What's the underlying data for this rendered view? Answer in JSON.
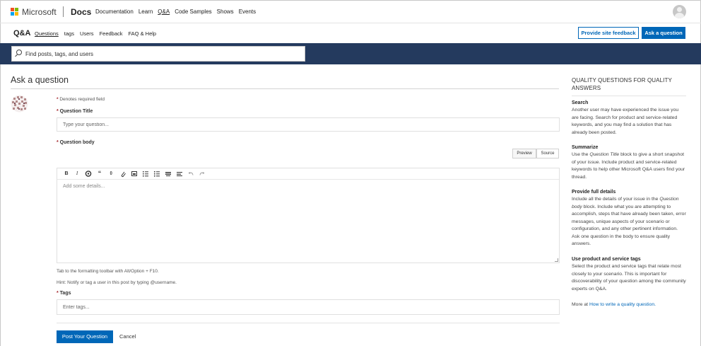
{
  "header": {
    "brand": "Microsoft",
    "product": "Docs",
    "nav": [
      "Documentation",
      "Learn",
      "Q&A",
      "Code Samples",
      "Shows",
      "Events"
    ],
    "active_nav": "Q&A",
    "logo_colors": [
      "#f25022",
      "#7fba00",
      "#00a4ef",
      "#ffb900"
    ]
  },
  "subnav": {
    "title": "Q&A",
    "items": [
      "Questions",
      "tags",
      "Users",
      "Feedback",
      "FAQ & Help"
    ],
    "active": "Questions",
    "feedback_button": "Provide site feedback",
    "ask_button": "Ask a question"
  },
  "search": {
    "placeholder": "Find posts, tags, and users",
    "icon": "search-icon"
  },
  "form": {
    "page_title": "Ask a question",
    "required_note": "Denotes required field",
    "question_title_label": "Question Title",
    "question_title_placeholder": "Type your question...",
    "question_body_label": "Question body",
    "preview_tab": "Preview",
    "source_tab": "Source",
    "editor_placeholder": "Add some details...",
    "toolbar": [
      "B",
      "I",
      "link-icon",
      "“",
      "code-icon",
      "attach-icon",
      "image-icon",
      "ordered-list-icon",
      "unordered-list-icon",
      "heading-icon",
      "hr-icon",
      "undo-icon",
      "redo-icon"
    ],
    "hint_toolbar": "Tab to the formatting toolbar with Alt/Option + F10.",
    "hint_notify": "Hint: Notify or tag a user in this post by typing @username.",
    "tags_label": "Tags",
    "tags_placeholder": "Enter tags...",
    "post_button": "Post Your Question",
    "cancel_button": "Cancel"
  },
  "sidebar": {
    "title": "QUALITY QUESTIONS FOR QUALITY ANSWERS",
    "sections": [
      {
        "heading": "Search",
        "text": "Another user may have experienced the issue you are facing. Search for product and service-related keywords, and you may find a solution that has already been posted."
      },
      {
        "heading": "Summarize",
        "text_before": "Use the ",
        "text_em": "Question Title",
        "text_after": " block to give a short snapshot of your issue. Include product and service-related keywords to help other Microsoft Q&A users find your thread."
      },
      {
        "heading": "Provide full details",
        "text_before": "Include all the details of your issue in the ",
        "text_em": "Question body",
        "text_after": " block. Include what you are attempting to accomplish, steps that have already been taken, error messages, unique aspects of your scenario or configuration, and any other pertinent information. Ask one question in the body to ensure quality answers."
      },
      {
        "heading": "Use product and service tags",
        "text": "Select the product and service tags that relate most closely to your scenario. This is important for discoverability of your question among the community experts on Q&A."
      }
    ],
    "more_prefix": "More at ",
    "more_link": "How to write a quality question."
  }
}
